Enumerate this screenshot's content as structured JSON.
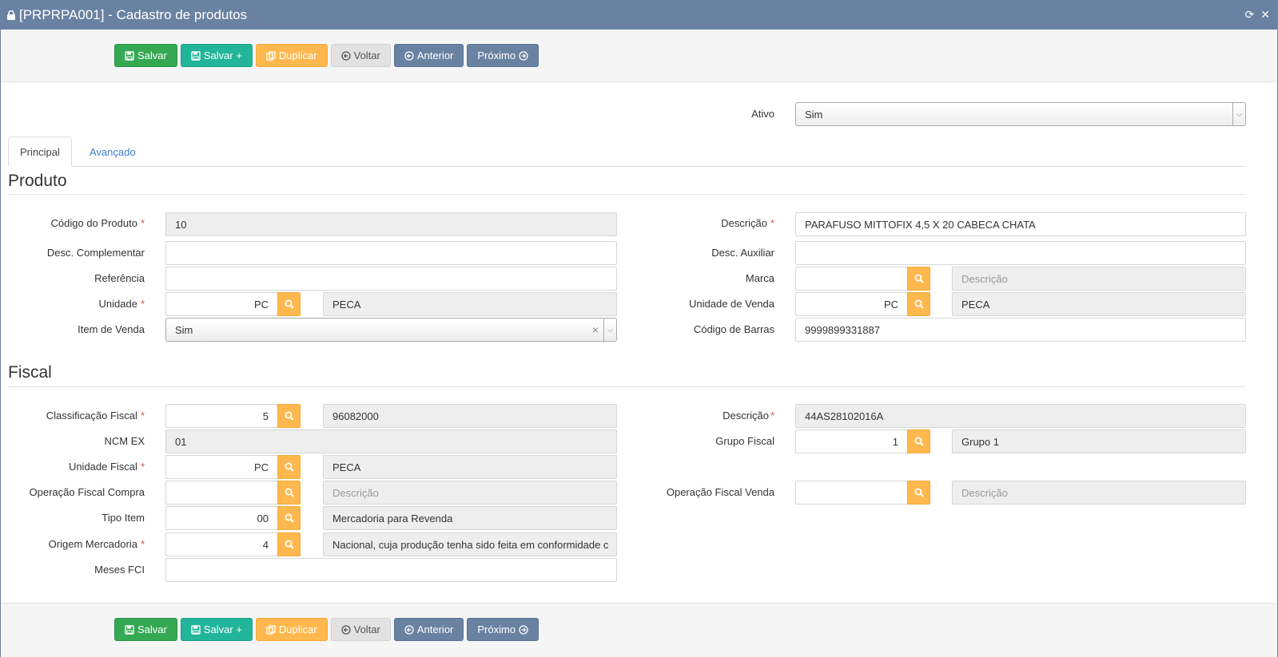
{
  "window": {
    "title": "[PRPRPA001] - Cadastro de produtos"
  },
  "toolbar": {
    "salvar": "Salvar",
    "salvar_plus": "Salvar +",
    "duplicar": "Duplicar",
    "voltar": "Voltar",
    "anterior": "Anterior",
    "proximo": "Próximo"
  },
  "ativo": {
    "label": "Ativo",
    "value": "Sim"
  },
  "tabs": [
    "Principal",
    "Avançado"
  ],
  "produto": {
    "title": "Produto",
    "codigo": {
      "label": "Código do Produto",
      "value": "10"
    },
    "descricao": {
      "label": "Descrição",
      "value": "PARAFUSO MITTOFIX 4,5 X 20 CABECA CHATA"
    },
    "desc_complementar": {
      "label": "Desc. Complementar",
      "value": ""
    },
    "desc_auxiliar": {
      "label": "Desc. Auxiliar",
      "value": ""
    },
    "referencia": {
      "label": "Referência",
      "value": ""
    },
    "marca": {
      "label": "Marca",
      "value": "",
      "desc_placeholder": "Descrição"
    },
    "unidade": {
      "label": "Unidade",
      "value": "PC",
      "desc": "PECA"
    },
    "unidade_venda": {
      "label": "Unidade de Venda",
      "value": "PC",
      "desc": "PECA"
    },
    "item_venda": {
      "label": "Item de Venda",
      "value": "Sim"
    },
    "codigo_barras": {
      "label": "Código de Barras",
      "value": "9999899331887"
    }
  },
  "fiscal": {
    "title": "Fiscal",
    "classificacao": {
      "label": "Classificação Fiscal",
      "value": "5",
      "desc": "96082000"
    },
    "descricao": {
      "label": "Descrição",
      "value": "44AS28102016A"
    },
    "ncm_ex": {
      "label": "NCM EX",
      "value": "01"
    },
    "grupo_fiscal": {
      "label": "Grupo Fiscal",
      "value": "1",
      "desc": "Grupo 1"
    },
    "unidade_fiscal": {
      "label": "Unidade Fiscal",
      "value": "PC",
      "desc": "PECA"
    },
    "op_compra": {
      "label": "Operação Fiscal Compra",
      "value": "",
      "desc_placeholder": "Descrição"
    },
    "op_venda": {
      "label": "Operação Fiscal Venda",
      "value": "",
      "desc_placeholder": "Descrição"
    },
    "tipo_item": {
      "label": "Tipo Item",
      "value": "00",
      "desc": "Mercadoria para Revenda"
    },
    "origem": {
      "label": "Origem Mercadoria",
      "value": "4",
      "desc": "Nacional, cuja produção tenha sido feita em conformidade c"
    },
    "meses_fci": {
      "label": "Meses FCI",
      "value": ""
    }
  },
  "colors": {
    "titlebar": "#6a82a2",
    "search": "#ffb84d",
    "green": "#34a853",
    "teal": "#22b59a",
    "required": "#d9534f"
  }
}
